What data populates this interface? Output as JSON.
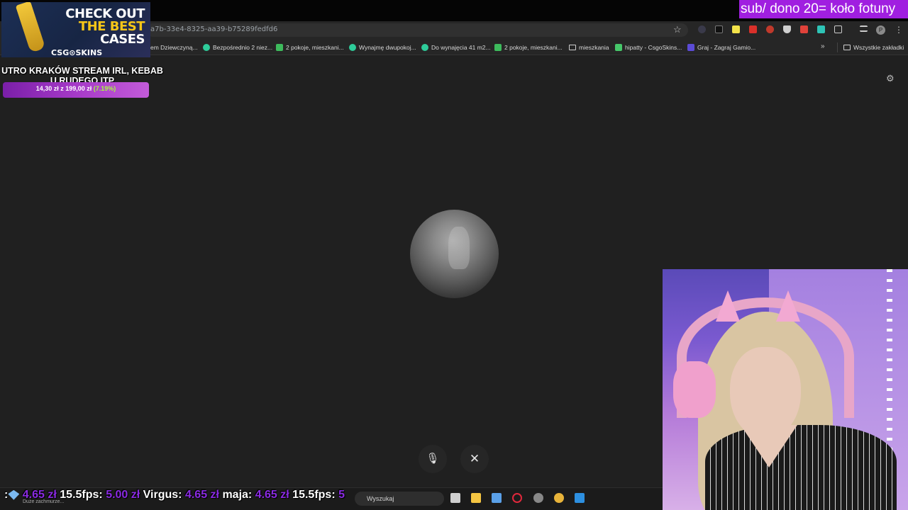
{
  "browser": {
    "url": "a7b-33e4-8325-aa39-b75289fedfd6",
    "bookmarks": [
      {
        "label": "em Dziewczyną...",
        "icon": "none"
      },
      {
        "label": "Bezpośrednio 2 niez...",
        "icon": "olx"
      },
      {
        "label": "2 pokoje, mieszkani...",
        "icon": "otodom"
      },
      {
        "label": "Wynajmę dwupokoj...",
        "icon": "olx"
      },
      {
        "label": "Do wynajęcia 41 m2...",
        "icon": "olx"
      },
      {
        "label": "2 pokoje, mieszkani...",
        "icon": "otodom"
      },
      {
        "label": "mieszkania",
        "icon": "folder"
      },
      {
        "label": "hipatty - CsgoSkins...",
        "icon": "csgoskins"
      },
      {
        "label": "Graj - Zagraj Gamio...",
        "icon": "gamio"
      }
    ],
    "all_bookmarks_label": "Wszystkie zakładki",
    "more_bookmarks_icon": "»",
    "profile_initial": "P",
    "menu_icon": "⋮"
  },
  "call": {
    "settings_icon": "sliders-icon",
    "mic_icon": "🎙",
    "close_icon": "✕"
  },
  "overlays": {
    "ad": {
      "line1": "CHECK OUT",
      "line2": "THE BEST",
      "line3": "CASES",
      "brand": "CSG⊙SKINS"
    },
    "stream_title": "UTRO KRAKÓW STREAM IRL, KEBAB U RUDEGO ITP",
    "goal": {
      "text": "14,30 zł z 199,00 zł",
      "percent": "(7.19%)",
      "fraction": 0.0719
    },
    "sub_banner": "sub/ dono 20= koło fotuny"
  },
  "taskbar": {
    "search_placeholder": "Wyszukaj",
    "weather_caption": "Duże zachmurze..."
  },
  "ticker": {
    "items": [
      {
        "name": ":",
        "amount": "4.65 zł"
      },
      {
        "name": "15.5fps:",
        "amount": "5.00 zł"
      },
      {
        "name": "Virgus:",
        "amount": "4.65 zł"
      },
      {
        "name": "maja:",
        "amount": "4.65 zł"
      },
      {
        "name": "15.5fps:",
        "amount": "5"
      }
    ]
  },
  "colors": {
    "sub_banner": "#a01fe0",
    "ticker_amount": "#8a2be2",
    "goal_percent": "#a6ff3c"
  }
}
